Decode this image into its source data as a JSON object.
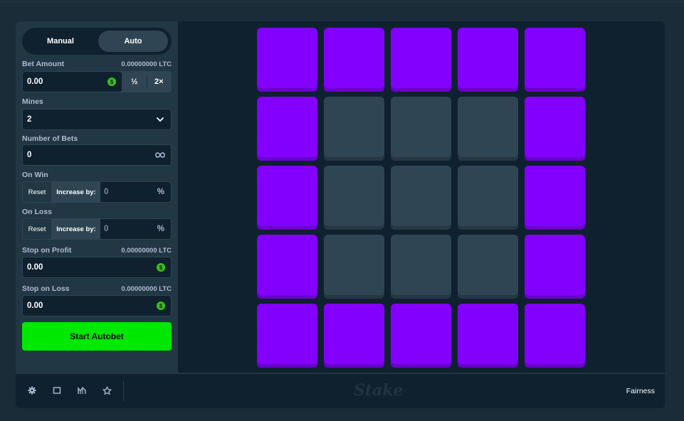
{
  "tabs": {
    "manual": "Manual",
    "auto": "Auto"
  },
  "bet_amount": {
    "label": "Bet Amount",
    "balance": "0.00000000 LTC",
    "value": "0.00",
    "half": "½",
    "double": "2×",
    "currency_icon": "dollar-coin-icon"
  },
  "mines": {
    "label": "Mines",
    "value": "2"
  },
  "number_of_bets": {
    "label": "Number of Bets",
    "value": "0"
  },
  "on_win": {
    "label": "On Win",
    "reset": "Reset",
    "increase": "Increase by:",
    "value": "0",
    "unit": "%"
  },
  "on_loss": {
    "label": "On Loss",
    "reset": "Reset",
    "increase": "Increase by:",
    "value": "0",
    "unit": "%"
  },
  "stop_on_profit": {
    "label": "Stop on Profit",
    "balance": "0.00000000 LTC",
    "value": "0.00"
  },
  "stop_on_loss": {
    "label": "Stop on Loss",
    "balance": "0.00000000 LTC",
    "value": "0.00"
  },
  "start_button": "Start Autobet",
  "coin_symbol": "$",
  "grid": {
    "rows": [
      [
        "selected",
        "selected",
        "selected",
        "selected",
        "selected"
      ],
      [
        "selected",
        "unselected",
        "unselected",
        "unselected",
        "selected"
      ],
      [
        "selected",
        "unselected",
        "unselected",
        "unselected",
        "selected"
      ],
      [
        "selected",
        "unselected",
        "unselected",
        "unselected",
        "selected"
      ],
      [
        "selected",
        "selected",
        "selected",
        "selected",
        "selected"
      ]
    ],
    "colors": {
      "selected": "#8300ff",
      "unselected": "#2f4553"
    }
  },
  "footer": {
    "logo": "Stake",
    "fairness": "Fairness",
    "icons": [
      "gear-icon",
      "theatre-mode-icon",
      "stats-icon",
      "favorite-star-icon"
    ]
  },
  "colors": {
    "accent_green": "#00e701",
    "background": "#0f212e",
    "panel": "#213743"
  }
}
